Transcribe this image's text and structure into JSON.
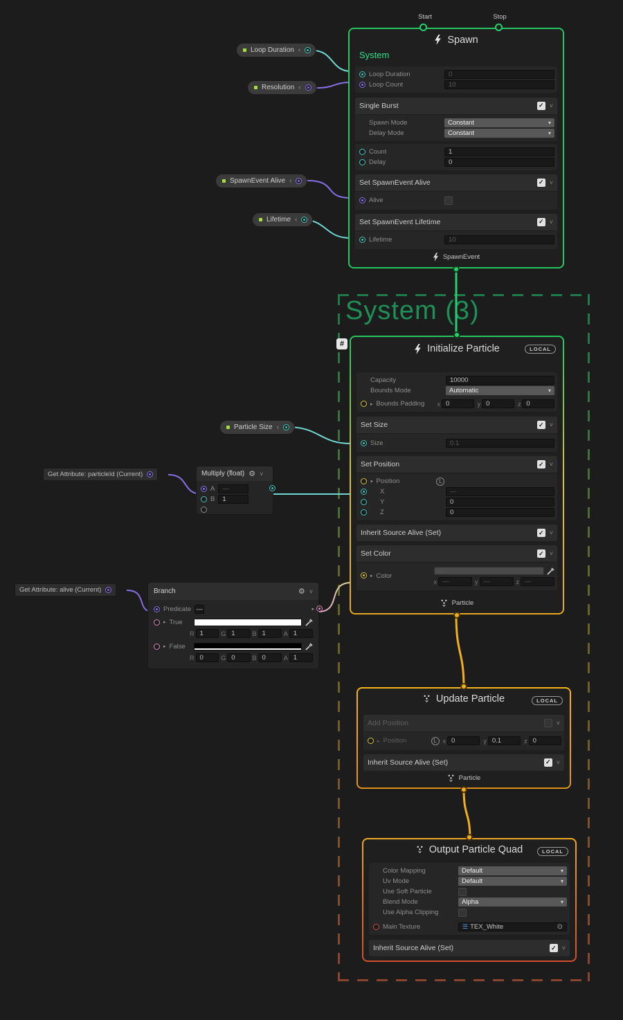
{
  "icons": {
    "collapse": "‹",
    "dropdown_arrow": "▾",
    "header_chevron": "˅",
    "gear": "⚙",
    "check": "✓",
    "minus": "—",
    "tri_right": "▸",
    "tri_down": "▾",
    "local_l": "L",
    "hash": "#",
    "texture": "☰",
    "picker": "⊙"
  },
  "colors": {
    "event_green": "#27d06e",
    "particle_yellow": "#f2b01e",
    "output_red": "#d14f2a",
    "float_cyan": "#6fd8d3",
    "uint_purple": "#8b6fe8",
    "color_pink": "#d687b8",
    "param_lime": "#a7e03c",
    "group_green": "#1f8f58",
    "group_brown": "#8a4430"
  },
  "pills": {
    "loop_duration": "Loop Duration",
    "resolution": "Resolution",
    "spawnevent_alive": "SpawnEvent Alive",
    "lifetime": "Lifetime",
    "particle_size": "Particle Size"
  },
  "group": {
    "label": "System (3)"
  },
  "spawn": {
    "title": "Spawn",
    "system_label": "System",
    "start_label": "Start",
    "stop_label": "Stop",
    "loop_duration": {
      "label": "Loop Duration",
      "value": "0"
    },
    "loop_count": {
      "label": "Loop Count",
      "value": "10"
    },
    "single_burst": {
      "title": "Single Burst",
      "spawn_mode": {
        "label": "Spawn Mode",
        "value": "Constant"
      },
      "delay_mode": {
        "label": "Delay Mode",
        "value": "Constant"
      },
      "count": {
        "label": "Count",
        "value": "1"
      },
      "delay": {
        "label": "Delay",
        "value": "0"
      }
    },
    "set_alive": {
      "title": "Set SpawnEvent Alive",
      "alive_label": "Alive"
    },
    "set_lifetime": {
      "title": "Set SpawnEvent Lifetime",
      "lifetime_label": "Lifetime",
      "lifetime_value": "10"
    },
    "footer": "SpawnEvent"
  },
  "initialize": {
    "title": "Initialize Particle",
    "badge": "LOCAL",
    "capacity": {
      "label": "Capacity",
      "value": "10000"
    },
    "bounds_mode": {
      "label": "Bounds Mode",
      "value": "Automatic"
    },
    "bounds_padding": {
      "label": "Bounds Padding",
      "x_label": "x",
      "x": "0",
      "y_label": "y",
      "y": "0",
      "z_label": "z",
      "z": "0"
    },
    "set_size": {
      "title": "Set Size",
      "size_label": "Size",
      "size_value": "0.1"
    },
    "set_position": {
      "title": "Set Position",
      "position_label": "Position",
      "x_label": "X",
      "x_value": "—",
      "y_label": "Y",
      "y_value": "0",
      "z_label": "Z",
      "z_value": "0"
    },
    "inherit": {
      "title": "Inherit Source Alive (Set)"
    },
    "set_color": {
      "title": "Set Color",
      "color_label": "Color",
      "swatch_value": "—",
      "x_label": "x",
      "x": "—",
      "y_label": "y",
      "y": "—",
      "z_label": "z",
      "z": "—"
    },
    "footer": "Particle"
  },
  "update": {
    "title": "Update Particle",
    "badge": "LOCAL",
    "add_position": {
      "title": "Add Position",
      "position_label": "Position",
      "x_label": "x",
      "x": "0",
      "y_label": "y",
      "y": "0.1",
      "z_label": "z",
      "z": "0"
    },
    "inherit": {
      "title": "Inherit Source Alive (Set)"
    },
    "footer": "Particle"
  },
  "output": {
    "title": "Output Particle Quad",
    "badge": "LOCAL",
    "color_mapping": {
      "label": "Color Mapping",
      "value": "Default"
    },
    "uv_mode": {
      "label": "Uv Mode",
      "value": "Default"
    },
    "use_soft_particle": {
      "label": "Use Soft Particle"
    },
    "blend_mode": {
      "label": "Blend Mode",
      "value": "Alpha"
    },
    "use_alpha_clipping": {
      "label": "Use Alpha Clipping"
    },
    "main_texture": {
      "label": "Main Texture",
      "value": "TEX_White"
    },
    "inherit": {
      "title": "Inherit Source Alive (Set)"
    }
  },
  "multiply": {
    "title": "Multiply (float)",
    "a": {
      "label": "A",
      "value": "—"
    },
    "b": {
      "label": "B",
      "value": "1"
    }
  },
  "branch": {
    "title": "Branch",
    "predicate_label": "Predicate",
    "true_row": {
      "label": "True",
      "r_label": "R",
      "r": "1",
      "g_label": "G",
      "g": "1",
      "b_label": "B",
      "b": "1",
      "a_label": "A",
      "a": "1"
    },
    "false_row": {
      "label": "False",
      "r_label": "R",
      "r": "0",
      "g_label": "G",
      "g": "0",
      "b_label": "B",
      "b": "0",
      "a_label": "A",
      "a": "1"
    }
  },
  "getattr_particleid": {
    "label": "Get Attribute: particleId (Current)"
  },
  "getattr_alive": {
    "label": "Get Attribute: alive (Current)"
  }
}
